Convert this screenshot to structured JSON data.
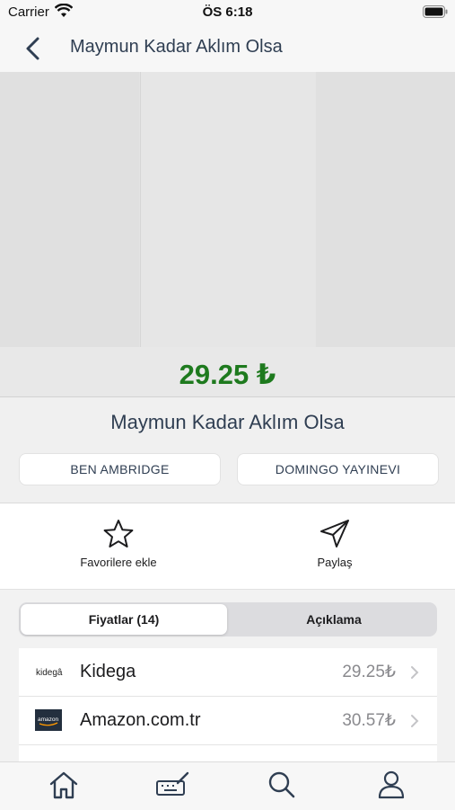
{
  "status_bar": {
    "carrier": "Carrier",
    "time": "ÖS 6:18"
  },
  "nav": {
    "title": "Maymun Kadar Aklım Olsa"
  },
  "product": {
    "price": "29.25 ₺",
    "title": "Maymun Kadar Aklım Olsa",
    "author": "BEN AMBRIDGE",
    "publisher": "DOMINGO YAYINEVI"
  },
  "actions": {
    "favorite_label": "Favorilere ekle",
    "share_label": "Paylaş"
  },
  "segments": {
    "prices_label": "Fiyatlar (14)",
    "description_label": "Açıklama",
    "selected": "Fiyatlar (14)"
  },
  "sellers": [
    {
      "logo_text": "kidegâ",
      "name": "Kidega",
      "price": "29.25₺"
    },
    {
      "logo_text": "amazon",
      "name": "Amazon.com.tr",
      "price": "30.57₺"
    }
  ],
  "tabs": [
    "home-icon",
    "write-icon",
    "search-icon",
    "profile-icon"
  ],
  "colors": {
    "price": "#1e7a1e",
    "title": "#2f3e52",
    "background": "#f2f2f2"
  }
}
